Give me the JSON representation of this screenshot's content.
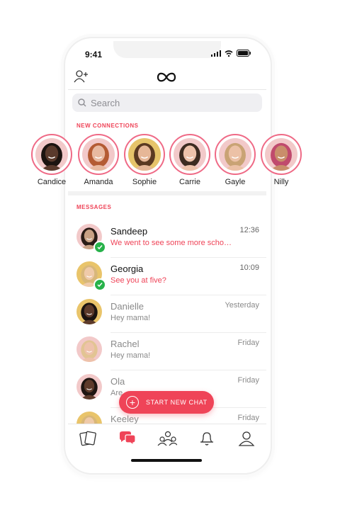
{
  "status": {
    "time": "9:41"
  },
  "search": {
    "placeholder": "Search"
  },
  "sections": {
    "new_connections": "NEW CONNECTIONS",
    "messages": "MESSAGES"
  },
  "connections": [
    {
      "name": "Candice",
      "skin": "#5a3a2c",
      "hair": "#1c1410",
      "bg": "#f2c9c9"
    },
    {
      "name": "Amanda",
      "skin": "#e8b9a0",
      "hair": "#b45b33",
      "bg": "#f2c9c9"
    },
    {
      "name": "Sophie",
      "skin": "#e6b797",
      "hair": "#5b3a22",
      "bg": "#e6c46a"
    },
    {
      "name": "Carrie",
      "skin": "#eec2ab",
      "hair": "#3d2b21",
      "bg": "#f2c9c9"
    },
    {
      "name": "Gayle",
      "skin": "#ecc1a6",
      "hair": "#c9a374",
      "bg": "#f2c9c9"
    },
    {
      "name": "Nilly",
      "skin": "#c98e6b",
      "hair": "#c04a6d",
      "bg": "#f2c9c9"
    }
  ],
  "messages": [
    {
      "name": "Sandeep",
      "preview": "We went to see some more scho…",
      "time": "12:36",
      "unread": true,
      "online": true,
      "skin": "#c9a184",
      "hair": "#2a1c16",
      "bg": "#f2c9c9"
    },
    {
      "name": "Georgia",
      "preview": "See you at five?",
      "time": "10:09",
      "unread": true,
      "online": true,
      "skin": "#efcaa9",
      "hair": "#d8b77a",
      "bg": "#e9c46a"
    },
    {
      "name": "Danielle",
      "preview": "Hey mama!",
      "time": "Yesterday",
      "unread": false,
      "online": false,
      "skin": "#5c3a2a",
      "hair": "#1a1310",
      "bg": "#e9c46a"
    },
    {
      "name": "Rachel",
      "preview": "Hey mama!",
      "time": "Friday",
      "unread": false,
      "online": false,
      "skin": "#eec2ab",
      "hair": "#e2c493",
      "bg": "#f2c9c9"
    },
    {
      "name": "Ola",
      "preview": "Are",
      "time": "Friday",
      "unread": false,
      "online": false,
      "skin": "#5e3b2b",
      "hair": "#1f1612",
      "bg": "#f2c9c9"
    },
    {
      "name": "Keeley",
      "preview": "",
      "time": "Friday",
      "unread": false,
      "online": false,
      "skin": "#efcaa9",
      "hair": "#d9b777",
      "bg": "#e9c46a"
    }
  ],
  "fab": {
    "label": "START NEW CHAT"
  },
  "tabs": [
    "cards-icon",
    "chat-icon",
    "community-icon",
    "bell-icon",
    "profile-icon"
  ],
  "colors": {
    "accent": "#ef4458",
    "ring": "#ef6a86",
    "online": "#27b24a"
  }
}
